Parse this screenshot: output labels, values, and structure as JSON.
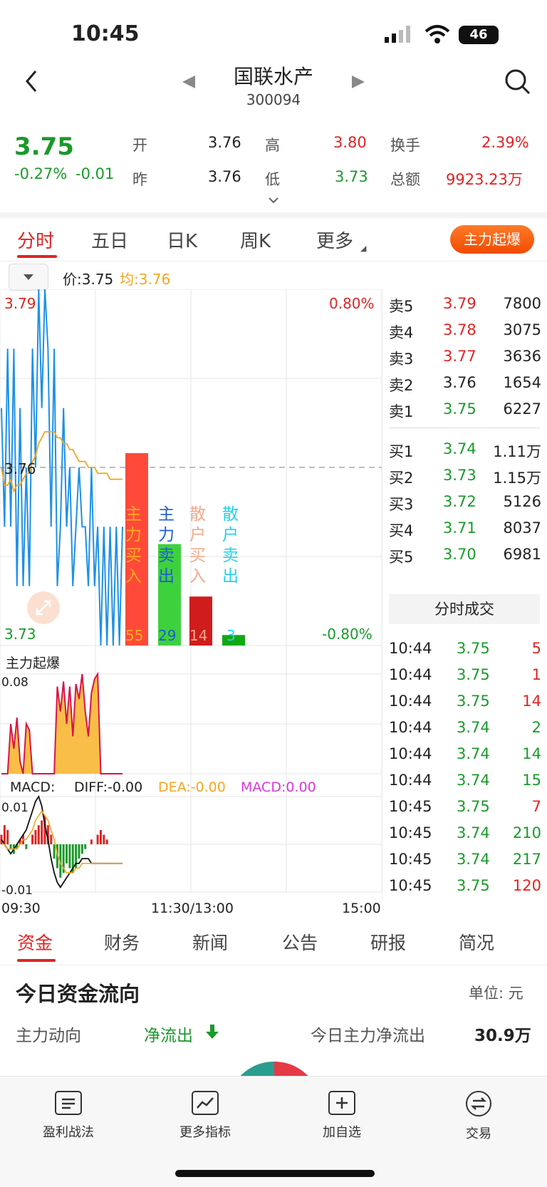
{
  "status": {
    "time": "10:45",
    "battery": "46"
  },
  "header": {
    "title": "国联水产",
    "code": "300094"
  },
  "quote": {
    "price": "3.75",
    "change_pct": "-0.27%",
    "change": "-0.01",
    "open_label": "开",
    "open": "3.76",
    "high_label": "高",
    "high": "3.80",
    "turnover_label": "换手",
    "turnover": "2.39%",
    "prev_label": "昨",
    "prev": "3.76",
    "low_label": "低",
    "low": "3.73",
    "amount_label": "总额",
    "amount": "9923.23万"
  },
  "tabs": [
    {
      "label": "分时"
    },
    {
      "label": "五日"
    },
    {
      "label": "日K"
    },
    {
      "label": "周K"
    },
    {
      "label": "更多"
    }
  ],
  "pill_label": "主力起爆",
  "price_bar": {
    "price_text": "价:3.75",
    "avg_text": "均:3.76"
  },
  "chart_labels": {
    "top_price": "3.79",
    "mid_price": "3.76",
    "bottom_price": "3.73",
    "top_pct": "0.80%",
    "bottom_pct": "-0.80%"
  },
  "indicator2": {
    "title": "主力起爆",
    "top": "0.08"
  },
  "macd": {
    "label": "MACD:",
    "diff": "DIFF:-0.00",
    "dea": "DEA:-0.00",
    "macd": "MACD:0.00",
    "top": "0.01",
    "bottom": "-0.01"
  },
  "time_axis": {
    "start": "09:30",
    "mid": "11:30/13:00",
    "end": "15:00"
  },
  "chart_data": [
    {
      "type": "bar",
      "categories": [
        "主力买入",
        "主力卖出",
        "散户买入",
        "散户卖出"
      ],
      "values": [
        55,
        29,
        14,
        3
      ],
      "colors": [
        "#ff4a3a",
        "#3ed13e",
        "#d01c1c",
        "#12a812"
      ],
      "label_colors": [
        "#ffb020",
        "#1f5cd1",
        "#f5a88a",
        "#22d3e8"
      ]
    },
    {
      "type": "line",
      "x_range": [
        "09:30",
        "15:00"
      ],
      "ylim": [
        3.73,
        3.79
      ],
      "series": [
        {
          "values": [
            3.77,
            3.75,
            3.78,
            3.75,
            3.78,
            3.74,
            3.77,
            3.74,
            3.76,
            3.74,
            3.78,
            3.76,
            3.79,
            3.77,
            3.79,
            3.78,
            3.75,
            3.78,
            3.74,
            3.75,
            3.77,
            3.75,
            3.76,
            3.74,
            3.75,
            3.76,
            3.75,
            3.75,
            3.74,
            3.76,
            3.74,
            3.75,
            3.73,
            3.75,
            3.73,
            3.75,
            3.73,
            3.75,
            3.73,
            3.75
          ]
        },
        {
          "values": [
            3.76,
            3.757,
            3.757,
            3.758,
            3.756,
            3.757,
            3.757,
            3.758,
            3.759,
            3.759,
            3.761,
            3.762,
            3.764,
            3.765,
            3.766,
            3.766,
            3.766,
            3.766,
            3.765,
            3.765,
            3.764,
            3.764,
            3.763,
            3.763,
            3.762,
            3.761,
            3.761,
            3.761,
            3.76,
            3.76,
            3.76,
            3.759,
            3.759,
            3.759,
            3.759,
            3.758,
            3.758,
            3.758,
            3.758,
            3.758
          ]
        }
      ]
    },
    {
      "type": "area",
      "ylim": [
        0,
        0.08
      ],
      "values": [
        0,
        0,
        0,
        0.04,
        0.02,
        0.045,
        0.01,
        0,
        0.04,
        0.035,
        0,
        0,
        0,
        0,
        0,
        0,
        0,
        0,
        0.07,
        0.05,
        0.074,
        0.04,
        0.07,
        0.03,
        0.072,
        0.06,
        0.08,
        0.05,
        0.03,
        0.065,
        0.076,
        0.08,
        0,
        0,
        0,
        0,
        0,
        0,
        0,
        0
      ]
    },
    {
      "type": "bar",
      "ylim": [
        -0.01,
        0.01
      ],
      "values": [
        0.002,
        0.004,
        0.003,
        -0.001,
        -0.002,
        -0.001,
        0.001,
        0.002,
        -0.001,
        0,
        0.002,
        0.003,
        0.004,
        0.005,
        0.006,
        0.004,
        0.002,
        -0.003,
        -0.005,
        -0.007,
        -0.006,
        -0.004,
        -0.005,
        -0.006,
        -0.005,
        -0.003,
        -0.002,
        -0.001,
        0,
        0.001,
        0,
        0.002,
        0.003,
        0.002,
        0.001,
        0,
        0,
        0,
        0,
        0
      ],
      "series": [
        {
          "name": "DIFF",
          "values": [
            0.001,
            0.0,
            -0.001,
            -0.002,
            -0.001,
            0,
            0.001,
            0.002,
            0.003,
            0.005,
            0.007,
            0.009,
            0.01,
            0.008,
            0.004,
            0.001,
            -0.003,
            -0.006,
            -0.008,
            -0.009,
            -0.008,
            -0.007,
            -0.006,
            -0.005,
            -0.004,
            -0.004,
            -0.003,
            -0.003,
            -0.003,
            -0.004,
            -0.004,
            -0.004,
            -0.004,
            -0.004,
            -0.004,
            -0.004,
            -0.004,
            -0.004,
            -0.004,
            -0.004
          ]
        },
        {
          "name": "DEA",
          "values": [
            0,
            0,
            -0.001,
            -0.001,
            -0.001,
            -0.001,
            0,
            0.001,
            0.001,
            0.002,
            0.003,
            0.005,
            0.006,
            0.007,
            0.006,
            0.005,
            0.003,
            0.001,
            -0.002,
            -0.004,
            -0.005,
            -0.006,
            -0.006,
            -0.006,
            -0.005,
            -0.005,
            -0.004,
            -0.004,
            -0.004,
            -0.004,
            -0.004,
            -0.004,
            -0.004,
            -0.004,
            -0.004,
            -0.004,
            -0.004,
            -0.004,
            -0.004,
            -0.004
          ]
        }
      ]
    }
  ],
  "orderbook": {
    "sells": [
      {
        "label": "卖5",
        "price": "3.79",
        "vol": "7800"
      },
      {
        "label": "卖4",
        "price": "3.78",
        "vol": "3075"
      },
      {
        "label": "卖3",
        "price": "3.77",
        "vol": "3636"
      },
      {
        "label": "卖2",
        "price": "3.76",
        "vol": "1654"
      },
      {
        "label": "卖1",
        "price": "3.75",
        "vol": "6227"
      }
    ],
    "buys": [
      {
        "label": "买1",
        "price": "3.74",
        "vol": "1.11万"
      },
      {
        "label": "买2",
        "price": "3.73",
        "vol": "1.15万"
      },
      {
        "label": "买3",
        "price": "3.72",
        "vol": "5126"
      },
      {
        "label": "买4",
        "price": "3.71",
        "vol": "8037"
      },
      {
        "label": "买5",
        "price": "3.70",
        "vol": "6981"
      }
    ]
  },
  "trades_header": "分时成交",
  "trades": [
    {
      "time": "10:44",
      "price": "3.75",
      "vol": "5"
    },
    {
      "time": "10:44",
      "price": "3.75",
      "vol": "1"
    },
    {
      "time": "10:44",
      "price": "3.75",
      "vol": "14"
    },
    {
      "time": "10:44",
      "price": "3.74",
      "vol": "2"
    },
    {
      "time": "10:44",
      "price": "3.74",
      "vol": "14"
    },
    {
      "time": "10:44",
      "price": "3.74",
      "vol": "15"
    },
    {
      "time": "10:45",
      "price": "3.75",
      "vol": "7"
    },
    {
      "time": "10:45",
      "price": "3.74",
      "vol": "210"
    },
    {
      "time": "10:45",
      "price": "3.74",
      "vol": "217"
    },
    {
      "time": "10:45",
      "price": "3.75",
      "vol": "120"
    }
  ],
  "bottom_tabs": [
    {
      "label": "资金"
    },
    {
      "label": "财务"
    },
    {
      "label": "新闻"
    },
    {
      "label": "公告"
    },
    {
      "label": "研报"
    },
    {
      "label": "简况"
    }
  ],
  "fund_flow": {
    "title": "今日资金流向",
    "unit": "单位: 元",
    "main_label": "主力动向",
    "main_value": "净流出",
    "net_label": "今日主力净流出",
    "net_value": "30.9万"
  },
  "dock": [
    {
      "label": "盈利战法"
    },
    {
      "label": "更多指标"
    },
    {
      "label": "加自选"
    },
    {
      "label": "交易"
    }
  ]
}
